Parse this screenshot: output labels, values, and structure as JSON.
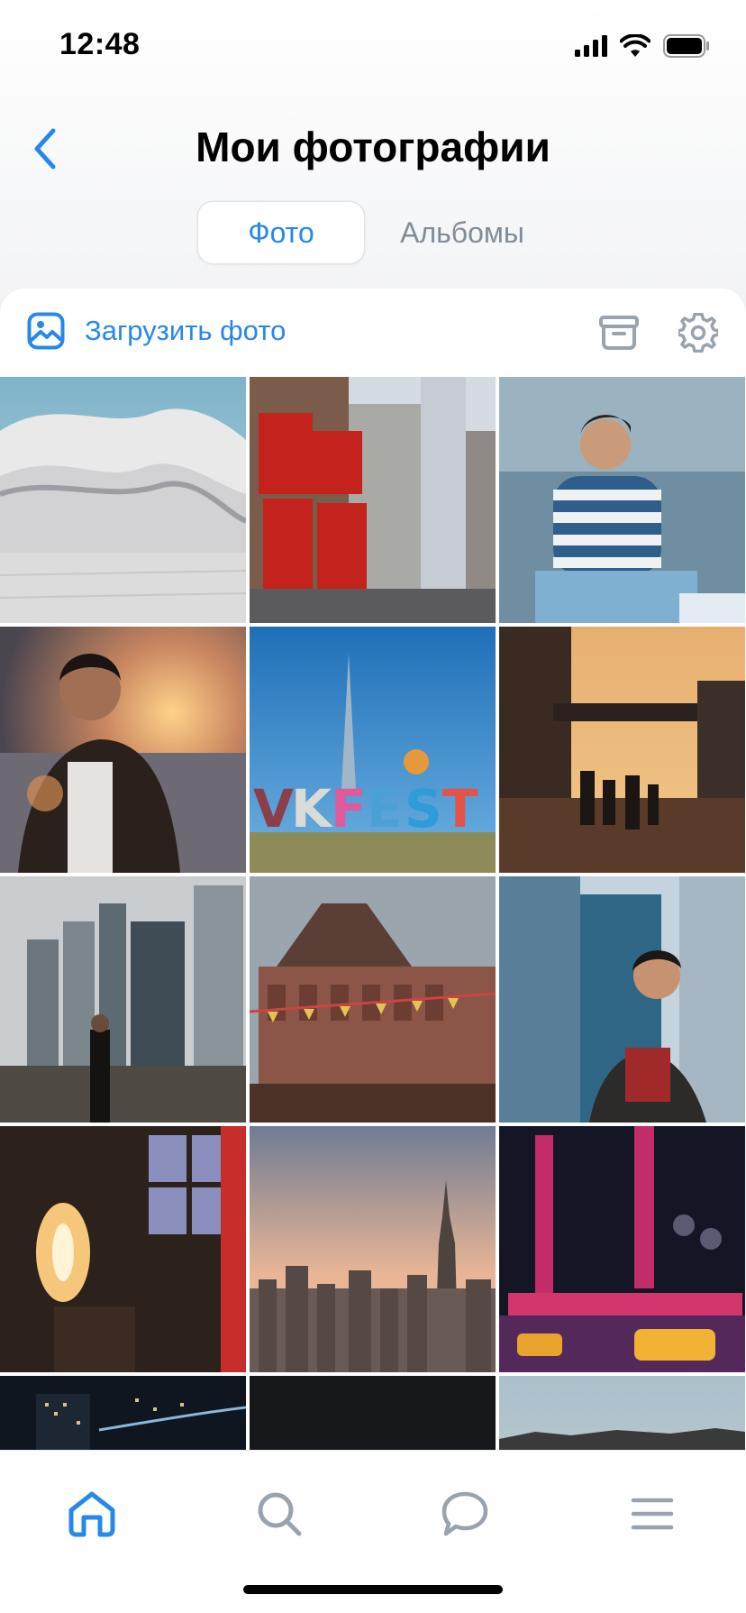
{
  "status_bar": {
    "time": "12:48"
  },
  "header": {
    "title": "Мои фотографии"
  },
  "tabs": [
    {
      "label": "Фото",
      "active": true
    },
    {
      "label": "Альбомы",
      "active": false
    }
  ],
  "toolbar": {
    "upload_label": "Загрузить фото"
  },
  "photos": [
    {
      "subject": "white-curved-architecture"
    },
    {
      "subject": "love-sculpture-street"
    },
    {
      "subject": "man-striped-shirt-sea"
    },
    {
      "subject": "man-sunset-portrait"
    },
    {
      "subject": "vkfest-sign-tower"
    },
    {
      "subject": "sunset-street-people"
    },
    {
      "subject": "skyscrapers-fog-man"
    },
    {
      "subject": "historic-building-flags"
    },
    {
      "subject": "man-glass-skyscrapers"
    },
    {
      "subject": "dark-room-window-light"
    },
    {
      "subject": "city-skyline-sunset"
    },
    {
      "subject": "radio-city-night"
    },
    {
      "subject": "night-city-lights"
    },
    {
      "subject": "dark-photo"
    },
    {
      "subject": "evening-sky-horizon"
    }
  ],
  "colors": {
    "accent": "#2688eb",
    "secondary": "#818c99",
    "icon_gray": "#99a2ad"
  },
  "bottom_nav": [
    "home-icon",
    "search-icon",
    "messages-icon",
    "menu-icon"
  ]
}
